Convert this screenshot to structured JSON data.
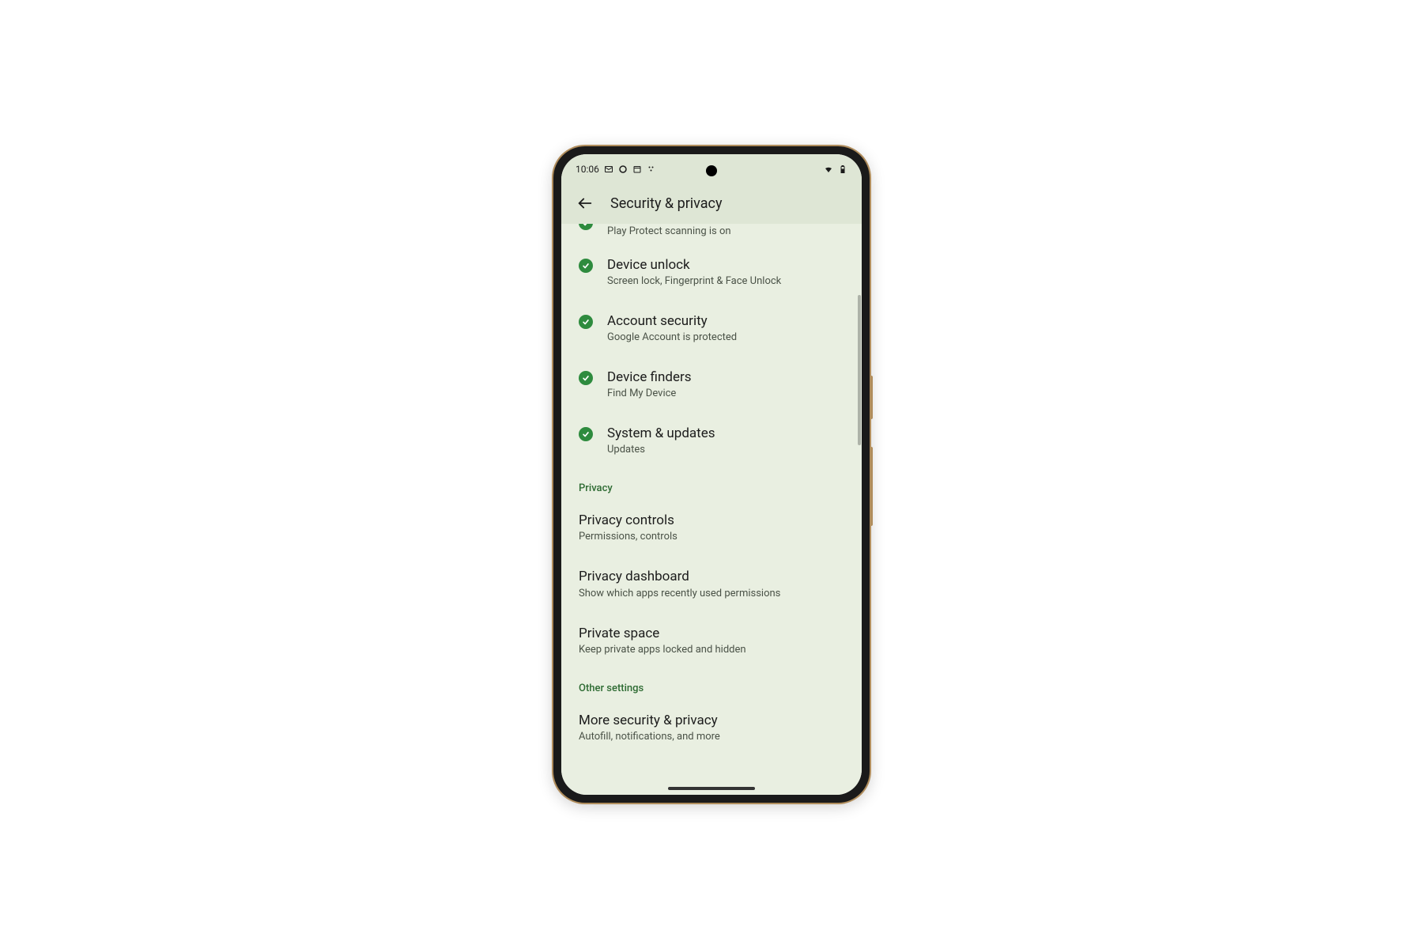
{
  "status": {
    "time": "10:06",
    "left_icon_names": [
      "gmail-icon",
      "circle-icon",
      "calendar-icon",
      "dots-icon"
    ],
    "right_icon_names": [
      "wifi-icon",
      "battery-icon"
    ]
  },
  "header": {
    "title": "Security & privacy",
    "back_icon": "arrow-back-icon"
  },
  "partial_item": {
    "subtitle": "Play Protect scanning is on"
  },
  "security_items": [
    {
      "title": "Device unlock",
      "subtitle": "Screen lock, Fingerprint & Face Unlock"
    },
    {
      "title": "Account security",
      "subtitle": "Google Account is protected"
    },
    {
      "title": "Device finders",
      "subtitle": "Find My Device"
    },
    {
      "title": "System & updates",
      "subtitle": "Updates"
    }
  ],
  "sections": [
    {
      "header": "Privacy",
      "items": [
        {
          "title": "Privacy controls",
          "subtitle": "Permissions, controls"
        },
        {
          "title": "Privacy dashboard",
          "subtitle": "Show which apps recently used permissions"
        },
        {
          "title": "Private space",
          "subtitle": "Keep private apps locked and hidden"
        }
      ]
    },
    {
      "header": "Other settings",
      "items": [
        {
          "title": "More security & privacy",
          "subtitle": "Autofill, notifications, and more"
        }
      ]
    }
  ],
  "colors": {
    "screen_bg": "#e9efe1",
    "header_bg": "#dee6d5",
    "accent_green": "#2e8b3e",
    "section_green": "#2e6b33"
  }
}
